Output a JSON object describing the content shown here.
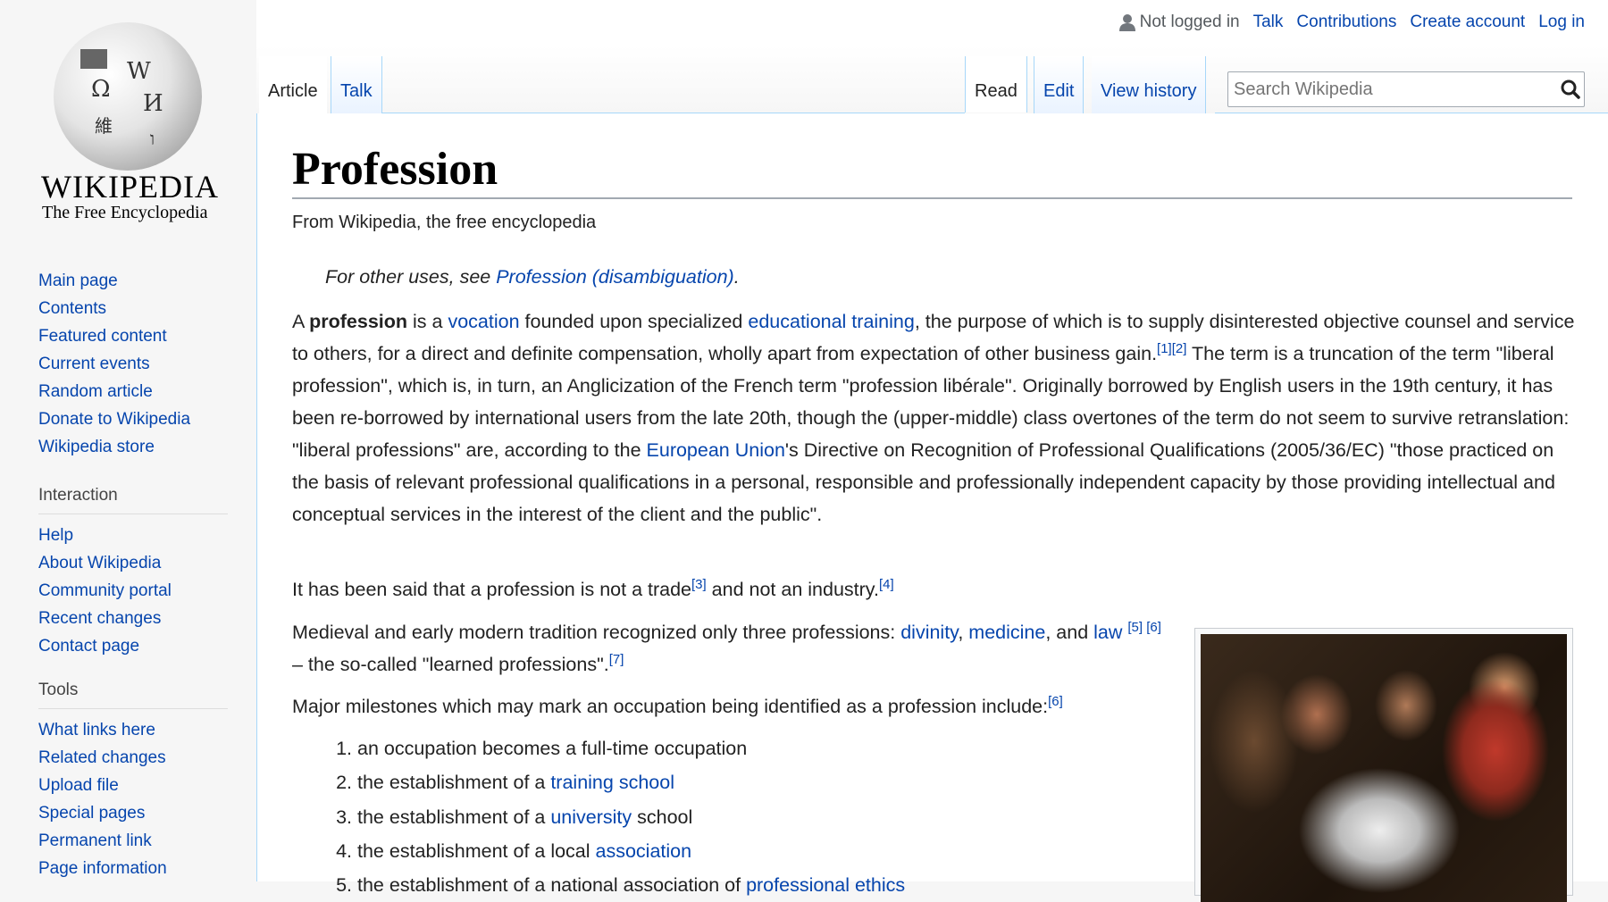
{
  "logo": {
    "wordmark": "WIKIPEDIA",
    "tagline": "The Free Encyclopedia"
  },
  "personal": {
    "status": "Not logged in",
    "talk": "Talk",
    "contributions": "Contributions",
    "create_account": "Create account",
    "login": "Log in"
  },
  "tabs": {
    "article": "Article",
    "talk": "Talk",
    "read": "Read",
    "edit": "Edit",
    "history": "View history"
  },
  "search": {
    "placeholder": "Search Wikipedia"
  },
  "nav": {
    "main": [
      "Main page",
      "Contents",
      "Featured content",
      "Current events",
      "Random article",
      "Donate to Wikipedia",
      "Wikipedia store"
    ],
    "interaction_heading": "Interaction",
    "interaction": [
      "Help",
      "About Wikipedia",
      "Community portal",
      "Recent changes",
      "Contact page"
    ],
    "tools_heading": "Tools",
    "tools": [
      "What links here",
      "Related changes",
      "Upload file",
      "Special pages",
      "Permanent link",
      "Page information"
    ]
  },
  "article": {
    "title": "Profession",
    "from": "From Wikipedia, the free encyclopedia",
    "hatnote": {
      "pre": "For other uses, see ",
      "link": "Profession (disambiguation)",
      "post": "."
    },
    "p1": {
      "a": "A ",
      "b": "profession",
      "c": " is a ",
      "l1": "vocation",
      "d": " founded upon specialized ",
      "l2": "educational training",
      "e": ", the purpose of which is to supply disinterested objective counsel and service to others, for a direct and definite compensation, wholly apart from expectation of other business gain.",
      "r1": "[1]",
      "r2": "[2]",
      "f": " The term is a truncation of the term \"liberal profession\", which is, in turn, an Anglicization of the French term \"profession libérale\". Originally borrowed by English users in the 19th century, it has been re-borrowed by international users from the late 20th, though the (upper-middle) class overtones of the term do not seem to survive retranslation: \"liberal professions\" are, according to the ",
      "l3": "European Union",
      "g": "'s Directive on Recognition of Professional Qualifications (2005/36/EC) \"those practiced on the basis of relevant professional qualifications in a personal, responsible and professionally independent capacity by those providing intellectual and conceptual services in the interest of the client and the public\"."
    },
    "p2": {
      "a": "It has been said that a profession is not a trade",
      "r3": "[3]",
      "b": " and not an industry.",
      "r4": "[4]"
    },
    "p3": {
      "a": "Medieval and early modern tradition recognized only three professions: ",
      "l1": "divinity",
      "b": ", ",
      "l2": "medicine",
      "c": ", and ",
      "l3": "law",
      "r5": "[5]",
      "r6": "[6]",
      "d": " – the so-called \"learned professions\".",
      "r7": "[7]"
    },
    "p4": {
      "a": "Major milestones which may mark an occupation being identified as a profession include:",
      "r6": "[6]"
    },
    "list": [
      {
        "pre": "an occupation becomes a full-time occupation",
        "link": "",
        "post": ""
      },
      {
        "pre": "the establishment of a ",
        "link": "training school",
        "post": ""
      },
      {
        "pre": "the establishment of a ",
        "link": "university",
        "post": " school"
      },
      {
        "pre": "the establishment of a local ",
        "link": "association",
        "post": ""
      },
      {
        "pre": "the establishment of a national association of ",
        "link": "professional ethics",
        "post": ""
      }
    ]
  },
  "colors": {
    "link": "#0645ad",
    "border": "#a7d7f9"
  }
}
